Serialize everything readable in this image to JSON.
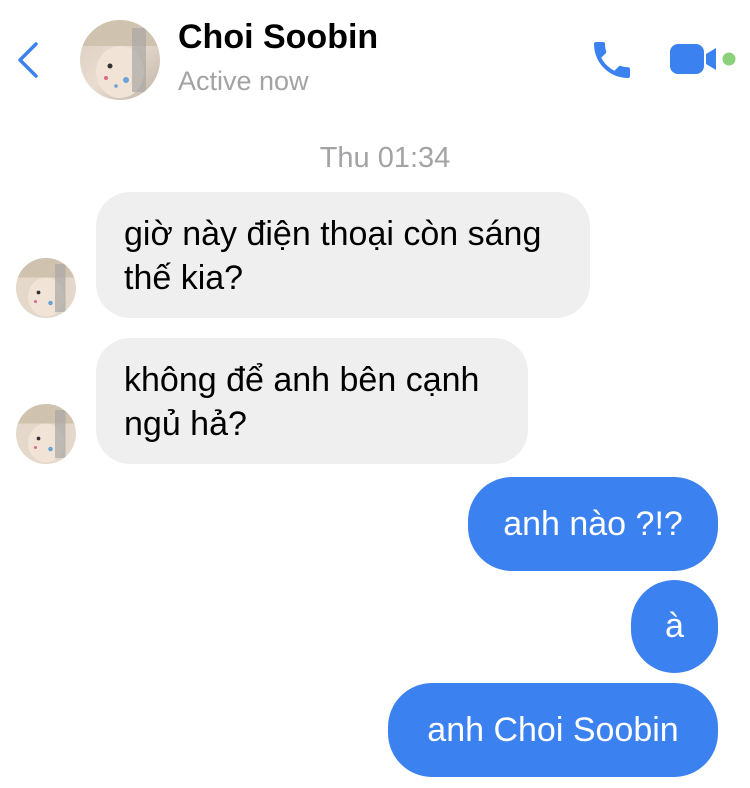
{
  "header": {
    "back_icon": "chevron-left-icon",
    "contact_name": "Choi Soobin",
    "status": "Active now",
    "call_icon": "phone-icon",
    "video_icon": "video-camera-icon",
    "active_dot_color": "#8bd17c"
  },
  "colors": {
    "accent": "#3b82f0",
    "incoming_bubble": "#efefef",
    "muted_text": "#a3a3a6"
  },
  "conversation": {
    "timestamp": "Thu 01:34",
    "messages": [
      {
        "direction": "incoming",
        "text": "giờ này điện thoại còn sáng\nthế kia?"
      },
      {
        "direction": "incoming",
        "text": "không để anh bên cạnh\nngủ hả?"
      },
      {
        "direction": "outgoing",
        "text": "anh nào ?!?"
      },
      {
        "direction": "outgoing",
        "text": "à"
      },
      {
        "direction": "outgoing",
        "text": "anh Choi Soobin"
      }
    ]
  }
}
